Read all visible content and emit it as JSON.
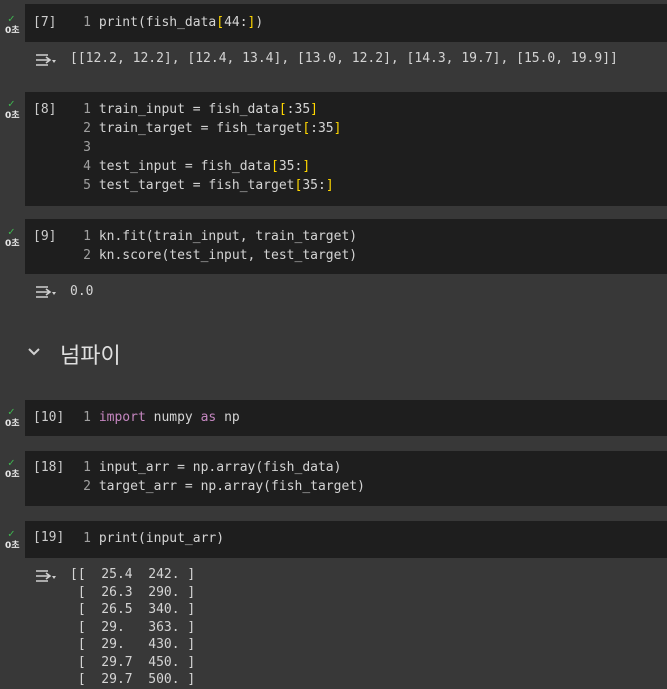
{
  "run_time": "0초",
  "cells": [
    {
      "exec": "[7]",
      "lines": [
        {
          "n": "1",
          "t": "print(fish_data[44:])"
        }
      ],
      "output": "[[12.2, 12.2], [12.4, 13.4], [13.0, 12.2], [14.3, 19.7], [15.0, 19.9]]"
    },
    {
      "exec": "[8]",
      "lines": [
        {
          "n": "1",
          "t": "train_input = fish_data[:35]"
        },
        {
          "n": "2",
          "t": "train_target = fish_target[:35]"
        },
        {
          "n": "3",
          "t": ""
        },
        {
          "n": "4",
          "t": "test_input = fish_data[35:]"
        },
        {
          "n": "5",
          "t": "test_target = fish_target[35:]"
        }
      ]
    },
    {
      "exec": "[9]",
      "lines": [
        {
          "n": "1",
          "t": "kn.fit(train_input, train_target)"
        },
        {
          "n": "2",
          "t": "kn.score(test_input, test_target)"
        }
      ],
      "output": "0.0"
    },
    {
      "exec": "[10]",
      "lines": [
        {
          "n": "1",
          "t": "import numpy as np"
        }
      ]
    },
    {
      "exec": "[18]",
      "lines": [
        {
          "n": "1",
          "t": "input_arr = np.array(fish_data)"
        },
        {
          "n": "2",
          "t": "target_arr = np.array(fish_target)"
        }
      ]
    },
    {
      "exec": "[19]",
      "lines": [
        {
          "n": "1",
          "t": "print(input_arr)"
        }
      ],
      "output_lines": [
        "[[  25.4  242. ]",
        " [  26.3  290. ]",
        " [  26.5  340. ]",
        " [  29.   363. ]",
        " [  29.   430. ]",
        " [  29.7  450. ]",
        " [  29.7  500. ]"
      ]
    }
  ],
  "section_heading": "넘파이",
  "colors": {
    "background": "#383838",
    "code_bg": "#1e1e1e",
    "check": "#3fb950",
    "keyword": "#c586c0",
    "bracket": "#ffd700"
  }
}
